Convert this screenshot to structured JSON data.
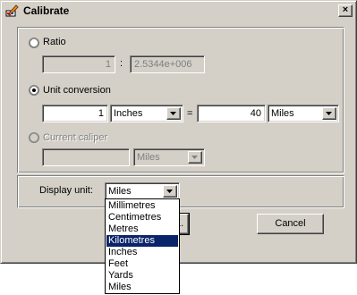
{
  "window": {
    "title": "Calibrate",
    "close_glyph": "×"
  },
  "ratio": {
    "label": "Ratio",
    "selected": false,
    "left_value": "1",
    "separator": ":",
    "right_value": "2.5344e+006"
  },
  "unit_conversion": {
    "label": "Unit conversion",
    "selected": true,
    "left_value": "1",
    "left_unit": "Inches",
    "equals": "=",
    "right_value": "40",
    "right_unit": "Miles"
  },
  "current_caliper": {
    "label": "Current caliper",
    "selected": false,
    "enabled": false,
    "value": "",
    "unit": "Miles"
  },
  "display_unit": {
    "label": "Display unit:",
    "value": "Miles",
    "options": [
      "Millimetres",
      "Centimetres",
      "Metres",
      "Kilometres",
      "Inches",
      "Feet",
      "Yards",
      "Miles"
    ],
    "highlighted": "Kilometres"
  },
  "buttons": {
    "ok_partial": "K.",
    "cancel": "Cancel"
  },
  "colors": {
    "face": "#d4d0c8",
    "highlight": "#0a246a"
  }
}
